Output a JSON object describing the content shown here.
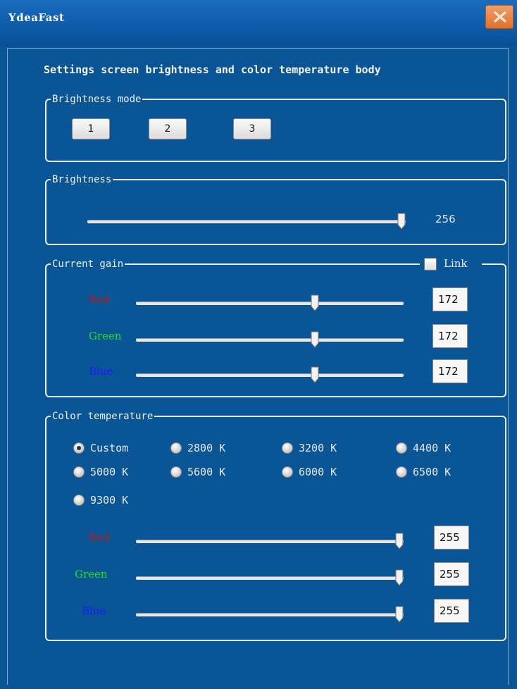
{
  "window": {
    "title": "YdeaFast"
  },
  "heading": "Settings screen brightness and color temperature body",
  "brightness_mode": {
    "legend": "Brightness mode",
    "buttons": [
      "1",
      "2",
      "3"
    ]
  },
  "brightness": {
    "legend": "Brightness",
    "value": "256",
    "slider_level": 1.0
  },
  "current_gain": {
    "legend": "Current gain",
    "link_label": "Link",
    "link_checked": false,
    "channels": [
      {
        "label": "Red",
        "value": "172",
        "color": "#c01818",
        "level": 0.675
      },
      {
        "label": "Green",
        "value": "172",
        "color": "#20e020",
        "level": 0.675
      },
      {
        "label": "Blue",
        "value": "172",
        "color": "#1a1aff",
        "level": 0.675
      }
    ]
  },
  "color_temperature": {
    "legend": "Color temperature",
    "selected": "Custom",
    "options": [
      "Custom",
      "2800 K",
      "3200 K",
      "4400 K",
      "5000 K",
      "5600 K",
      "6000 K",
      "6500 K",
      "9300 K"
    ],
    "channels": [
      {
        "label": "Red",
        "value": "255",
        "color": "#c01818",
        "level": 1.0
      },
      {
        "label": "Green",
        "value": "255",
        "color": "#20e020",
        "level": 1.0
      },
      {
        "label": "Blue",
        "value": "255",
        "color": "#1a1aff",
        "level": 1.0
      }
    ]
  },
  "colors": {
    "background": "#0a5596",
    "close_button": "#e0702a"
  }
}
